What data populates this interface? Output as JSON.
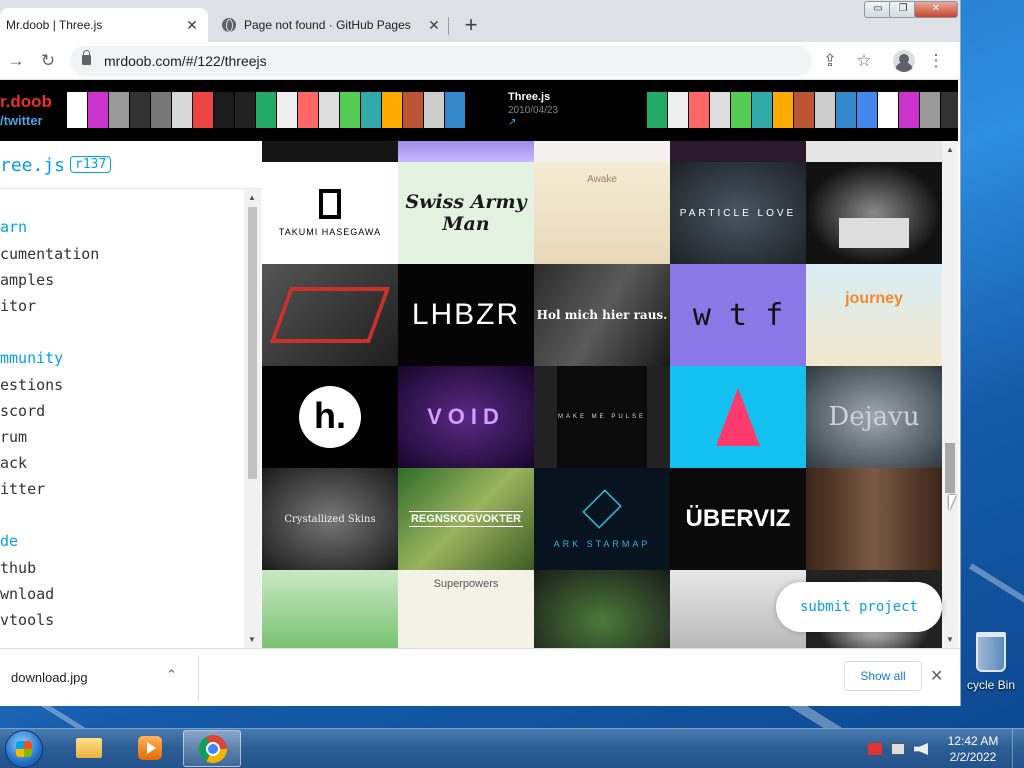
{
  "browser": {
    "tabs": [
      {
        "title": "Mr.doob | Three.js",
        "close": "✕"
      },
      {
        "title": "Page not found · GitHub Pages",
        "close": "✕"
      }
    ],
    "new_tab": "+",
    "url": "mrdoob.com/#/122/threejs",
    "window_controls": {
      "minimize": "▭",
      "maximize": "❐",
      "close": "✕"
    }
  },
  "header": {
    "logo_name": "r.doob",
    "logo_twitter": "/twitter",
    "selected_site": {
      "title": "Three.js",
      "date": "2010/04/23",
      "link_icon": "↗"
    }
  },
  "sidebar": {
    "title": "ree.js",
    "revision": "r137",
    "sections": [
      {
        "heading": "arn",
        "items": [
          "cumentation",
          "amples",
          "itor"
        ]
      },
      {
        "heading": "mmunity",
        "items": [
          "estions",
          "scord",
          "rum",
          "ack",
          "itter"
        ]
      },
      {
        "heading": "de",
        "items": [
          "thub",
          "wnload",
          "vtools"
        ]
      }
    ]
  },
  "grid": {
    "tiles": [
      {
        "label": "TAKUMI HASEGAWA"
      },
      {
        "label": "Swiss Army Man"
      },
      {
        "label": "Awake"
      },
      {
        "label": "PARTICLE LOVE"
      },
      {
        "label": ""
      },
      {
        "label": ""
      },
      {
        "label": "LHBZR"
      },
      {
        "label": "Hol mich hier raus."
      },
      {
        "label": "w t f"
      },
      {
        "label": "journey"
      },
      {
        "label": "h."
      },
      {
        "label": "VOID"
      },
      {
        "label": "MAKE ME PULSE"
      },
      {
        "label": ""
      },
      {
        "label": "Dejavu"
      },
      {
        "label": "Crystallized Skins"
      },
      {
        "label": "REGNSKOGVOKTER"
      },
      {
        "label": "ARK STARMAP"
      },
      {
        "label": "ÜBERVIZ"
      },
      {
        "label": ""
      },
      {
        "label": ""
      },
      {
        "label": "Superpowers"
      },
      {
        "label": ""
      },
      {
        "label": ""
      },
      {
        "label": ""
      }
    ]
  },
  "submit_button": "submit project",
  "downloads": {
    "file": "download.jpg",
    "chevron": "⌃",
    "show_all": "Show all",
    "close": "✕"
  },
  "desktop": {
    "recycle_bin": "cycle Bin"
  },
  "taskbar": {
    "time": "12:42 AM",
    "date": "2/2/2022"
  }
}
